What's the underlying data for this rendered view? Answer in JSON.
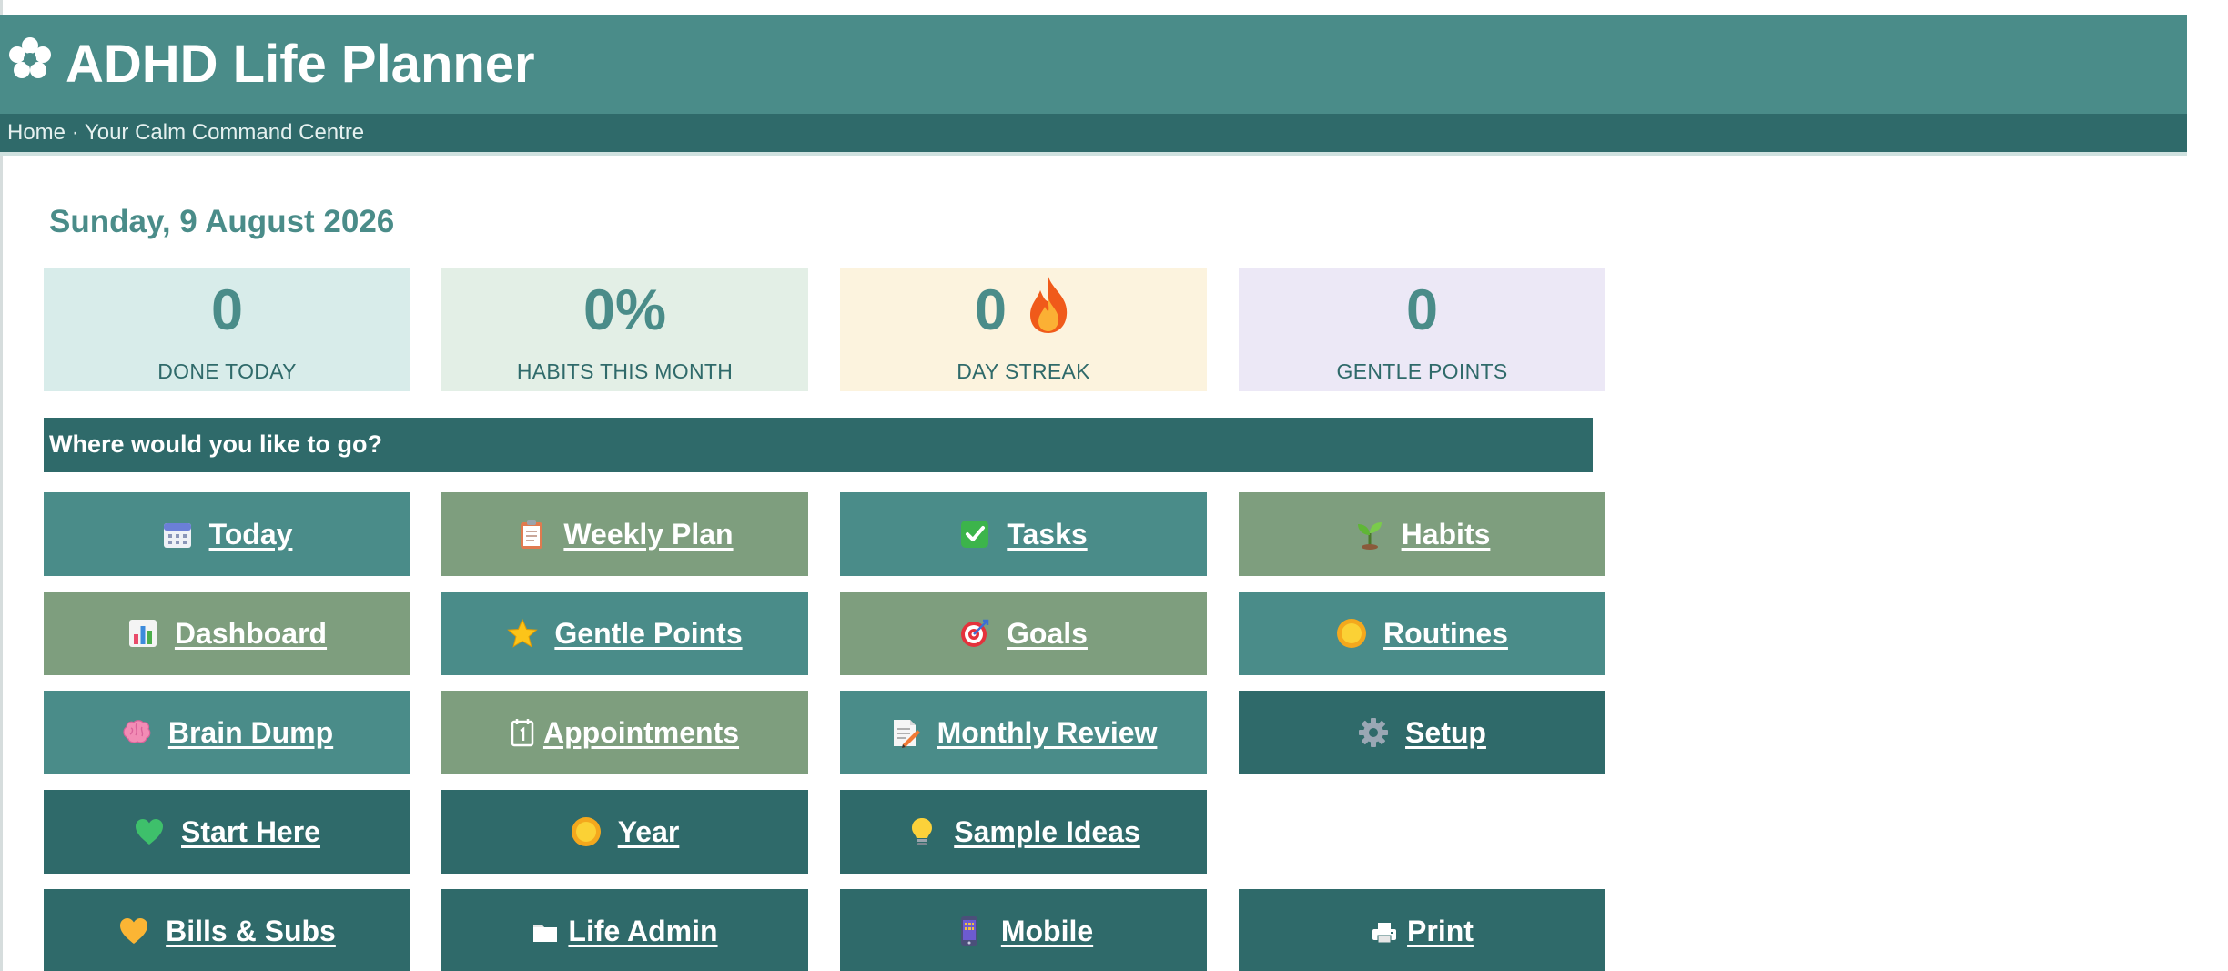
{
  "app": {
    "title": "ADHD Life Planner",
    "breadcrumb": "Home · Your Calm Command Centre"
  },
  "date": "Sunday, 9 August 2026",
  "stats": [
    {
      "value": "0",
      "label": "DONE TODAY",
      "color": "#d8ecea"
    },
    {
      "value": "0%",
      "label": "HABITS THIS MONTH",
      "color": "#e3efe6"
    },
    {
      "value": "0",
      "label": "DAY STREAK",
      "color": "#fcf3de",
      "icon": "fire-icon"
    },
    {
      "value": "0",
      "label": "GENTLE POINTS",
      "color": "#ece8f6"
    }
  ],
  "section": {
    "title": "Where would you like to go?"
  },
  "nav": [
    {
      "label": "Today",
      "icon": "calendar-icon"
    },
    {
      "label": "Weekly Plan",
      "icon": "clipboard-icon"
    },
    {
      "label": "Tasks",
      "icon": "checkmark-icon"
    },
    {
      "label": "Habits",
      "icon": "seedling-icon"
    },
    {
      "label": "Dashboard",
      "icon": "bar-chart-icon"
    },
    {
      "label": "Gentle Points",
      "icon": "star-icon"
    },
    {
      "label": "Goals",
      "icon": "target-icon"
    },
    {
      "label": "Routines",
      "icon": "sun-icon"
    },
    {
      "label": "Brain Dump",
      "icon": "brain-icon"
    },
    {
      "label": "Appointments",
      "icon": "calendar-page-icon"
    },
    {
      "label": "Monthly Review",
      "icon": "memo-icon"
    },
    {
      "label": "Setup",
      "icon": "gear-icon"
    },
    {
      "label": "Start Here",
      "icon": "green-heart-icon"
    },
    {
      "label": "Year",
      "icon": "sun-icon"
    },
    {
      "label": "Sample Ideas",
      "icon": "lightbulb-icon"
    },
    {
      "label": "Bills & Subs",
      "icon": "yellow-heart-icon"
    },
    {
      "label": "Life Admin",
      "icon": "folder-icon"
    },
    {
      "label": "Mobile",
      "icon": "mobile-phone-icon"
    },
    {
      "label": "Print",
      "icon": "printer-icon"
    }
  ],
  "colors": {
    "header": "#4a8c89",
    "subheader": "#2f6a6a",
    "tile_teal": "#4a8c89",
    "tile_sage": "#7e9e7e",
    "tile_dark": "#2f6a6a"
  }
}
